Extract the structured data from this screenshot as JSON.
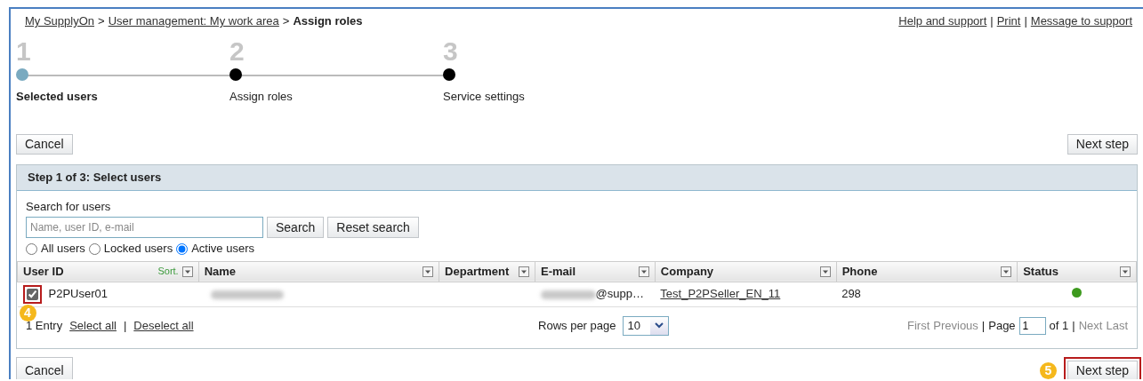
{
  "breadcrumb": [
    {
      "kind": "link",
      "text": "My SupplyOn"
    },
    {
      "kind": "separator",
      "text": ">"
    },
    {
      "kind": "link",
      "text": "User management: My work area"
    },
    {
      "kind": "separator",
      "text": ">"
    },
    {
      "kind": "current",
      "text": "Assign roles"
    }
  ],
  "top_links": [
    {
      "kind": "link",
      "text": "Help and support"
    },
    {
      "kind": "separator",
      "text": "|"
    },
    {
      "kind": "link",
      "text": "Print"
    },
    {
      "kind": "separator",
      "text": "|"
    },
    {
      "kind": "link",
      "text": "Message to support"
    }
  ],
  "steps": [
    {
      "number": "1",
      "label": "Selected users",
      "selected": true
    },
    {
      "number": "2",
      "label": "Assign roles",
      "selected": false
    },
    {
      "number": "3",
      "label": "Service settings",
      "selected": false
    }
  ],
  "top_buttons": {
    "cancel": "Cancel",
    "next": "Next step"
  },
  "panel": {
    "title": "Step 1 of 3: Select users",
    "search": {
      "label": "Search for users",
      "placeholder": "Name, user ID, e-mail",
      "search_button": "Search",
      "reset_button": "Reset search"
    },
    "filters": [
      {
        "label": "All users",
        "selected": false
      },
      {
        "label": "Locked users",
        "selected": false
      },
      {
        "label": "Active users",
        "selected": true
      }
    ],
    "columns": [
      {
        "label": "User ID",
        "sort_label": "Sort."
      },
      {
        "label": "Name"
      },
      {
        "label": "Department"
      },
      {
        "label": "E-mail"
      },
      {
        "label": "Company"
      },
      {
        "label": "Phone"
      },
      {
        "label": "Status"
      }
    ],
    "rows": [
      {
        "checked": true,
        "annotation": "4",
        "user_id": "P2PUser01",
        "email": "@supp…",
        "company": "Test_P2PSeller_EN_11",
        "phone": "298",
        "status": {
          "color": "#3d9a1e"
        }
      }
    ],
    "footer": {
      "count": "1 Entry",
      "select_all": "Select all",
      "separator": "|",
      "deselect_all": "Deselect all",
      "rows_per_page_label": "Rows per page",
      "rows_per_page": "10",
      "pager": [
        {
          "kind": "link",
          "text": "First",
          "disabled": true
        },
        {
          "kind": "link",
          "text": "Previous",
          "disabled": true
        },
        {
          "kind": "text",
          "text": "|"
        },
        {
          "kind": "text",
          "text": "Page"
        },
        {
          "kind": "input",
          "text": "1"
        },
        {
          "kind": "text",
          "text": "of 1"
        },
        {
          "kind": "text",
          "text": "|"
        },
        {
          "kind": "link",
          "text": "Next",
          "disabled": true
        },
        {
          "kind": "link",
          "text": "Last",
          "disabled": true
        }
      ]
    }
  },
  "bottom_buttons": {
    "cancel": "Cancel",
    "next": "Next step",
    "next_annotation": "5",
    "next_highlighted": true
  }
}
